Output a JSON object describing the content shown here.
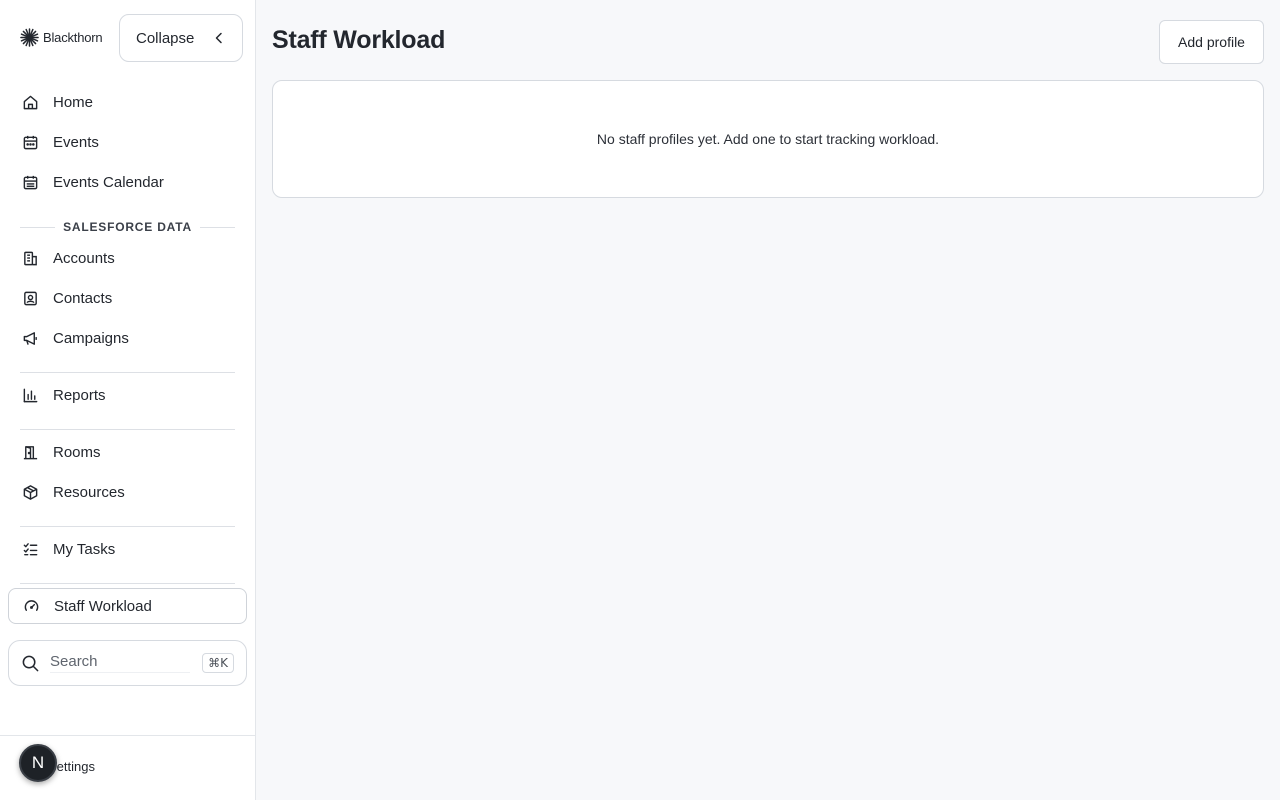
{
  "brand": {
    "name": "Blackthorn"
  },
  "sidebar": {
    "collapse_label": "Collapse",
    "items_top": [
      {
        "label": "Home",
        "icon": "home-icon"
      },
      {
        "label": "Events",
        "icon": "calendar-icon"
      },
      {
        "label": "Events Calendar",
        "icon": "calendar-grid-icon"
      }
    ],
    "section_label": "SALESFORCE DATA",
    "items_sf": [
      {
        "label": "Accounts",
        "icon": "building-icon"
      },
      {
        "label": "Contacts",
        "icon": "contact-card-icon"
      },
      {
        "label": "Campaigns",
        "icon": "megaphone-icon"
      }
    ],
    "reports": {
      "label": "Reports",
      "icon": "bar-chart-icon"
    },
    "rooms": {
      "label": "Rooms",
      "icon": "door-icon"
    },
    "resources": {
      "label": "Resources",
      "icon": "package-icon"
    },
    "my_tasks": {
      "label": "My Tasks",
      "icon": "task-list-icon"
    },
    "staff_workload": {
      "label": "Staff Workload",
      "icon": "gauge-icon",
      "active": true
    },
    "search": {
      "placeholder": "Search",
      "shortcut": "⌘K"
    },
    "settings_label": "Settings",
    "avatar_initial": "N"
  },
  "main": {
    "title": "Staff Workload",
    "add_button_label": "Add profile",
    "empty_message": "No staff profiles yet. Add one to start tracking workload."
  },
  "colors": {
    "text": "#23272e",
    "border": "#d6dae0",
    "background": "#f7f8fa",
    "avatar_bg": "#1e2227"
  }
}
